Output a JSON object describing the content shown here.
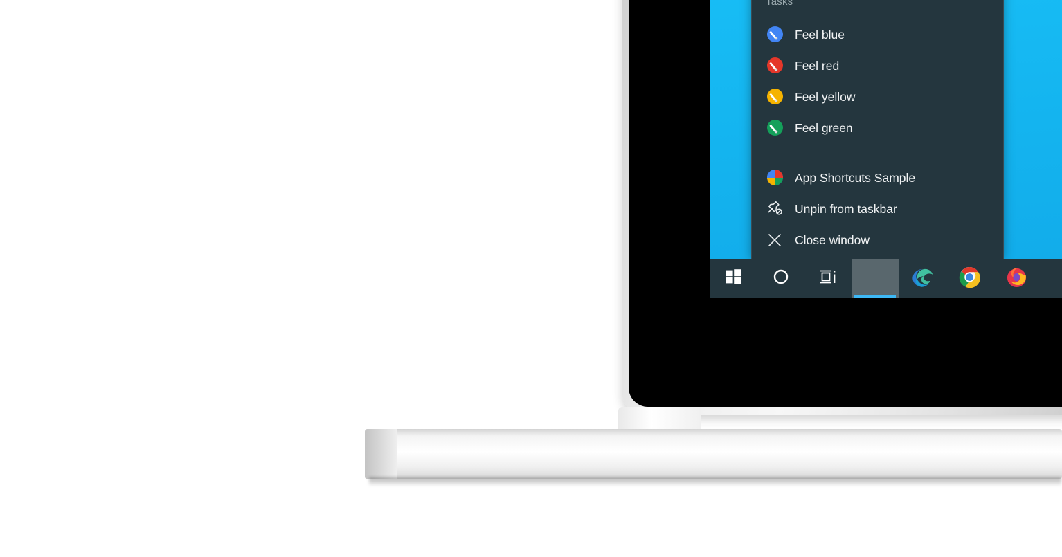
{
  "device": {
    "kind": "laptop-mockup",
    "bezel_color": "#000000",
    "shell_color": "#e9e9e9"
  },
  "desktop": {
    "wallpaper_color": "#18bdf5"
  },
  "jumplist": {
    "heading": "Tasks",
    "background": "#24363e",
    "text_color": "#f2f4f5",
    "heading_color": "#9aa9ae",
    "tasks": [
      {
        "label": "Feel blue",
        "icon": "paint-brush-blue-icon",
        "color": "#4285f4"
      },
      {
        "label": "Feel red",
        "icon": "paint-brush-red-icon",
        "color": "#e5372a"
      },
      {
        "label": "Feel yellow",
        "icon": "paint-brush-yellow-icon",
        "color": "#f5b300"
      },
      {
        "label": "Feel green",
        "icon": "paint-brush-green-icon",
        "color": "#14a05a"
      }
    ],
    "actions": [
      {
        "label": "App Shortcuts Sample",
        "icon": "app-pie-icon"
      },
      {
        "label": "Unpin from taskbar",
        "icon": "unpin-icon"
      },
      {
        "label": "Close window",
        "icon": "close-x-icon"
      }
    ]
  },
  "taskbar": {
    "background": "#24363e",
    "accent": "#3db8f5",
    "buttons": [
      {
        "name": "start",
        "icon": "windows-logo-icon",
        "label": "Start",
        "active": false
      },
      {
        "name": "cortana",
        "icon": "cortana-circle-icon",
        "label": "Search",
        "active": false
      },
      {
        "name": "task-view",
        "icon": "task-view-icon",
        "label": "Task View",
        "active": false
      },
      {
        "name": "app-shortcuts",
        "icon": "app-pie-icon",
        "label": "App Shortcuts Sample",
        "active": true
      },
      {
        "name": "microsoft-edge",
        "icon": "edge-icon",
        "label": "Microsoft Edge",
        "active": false
      },
      {
        "name": "google-chrome",
        "icon": "chrome-icon",
        "label": "Google Chrome",
        "active": false
      },
      {
        "name": "mozilla-firefox",
        "icon": "firefox-icon",
        "label": "Mozilla Firefox",
        "active": false
      }
    ]
  }
}
